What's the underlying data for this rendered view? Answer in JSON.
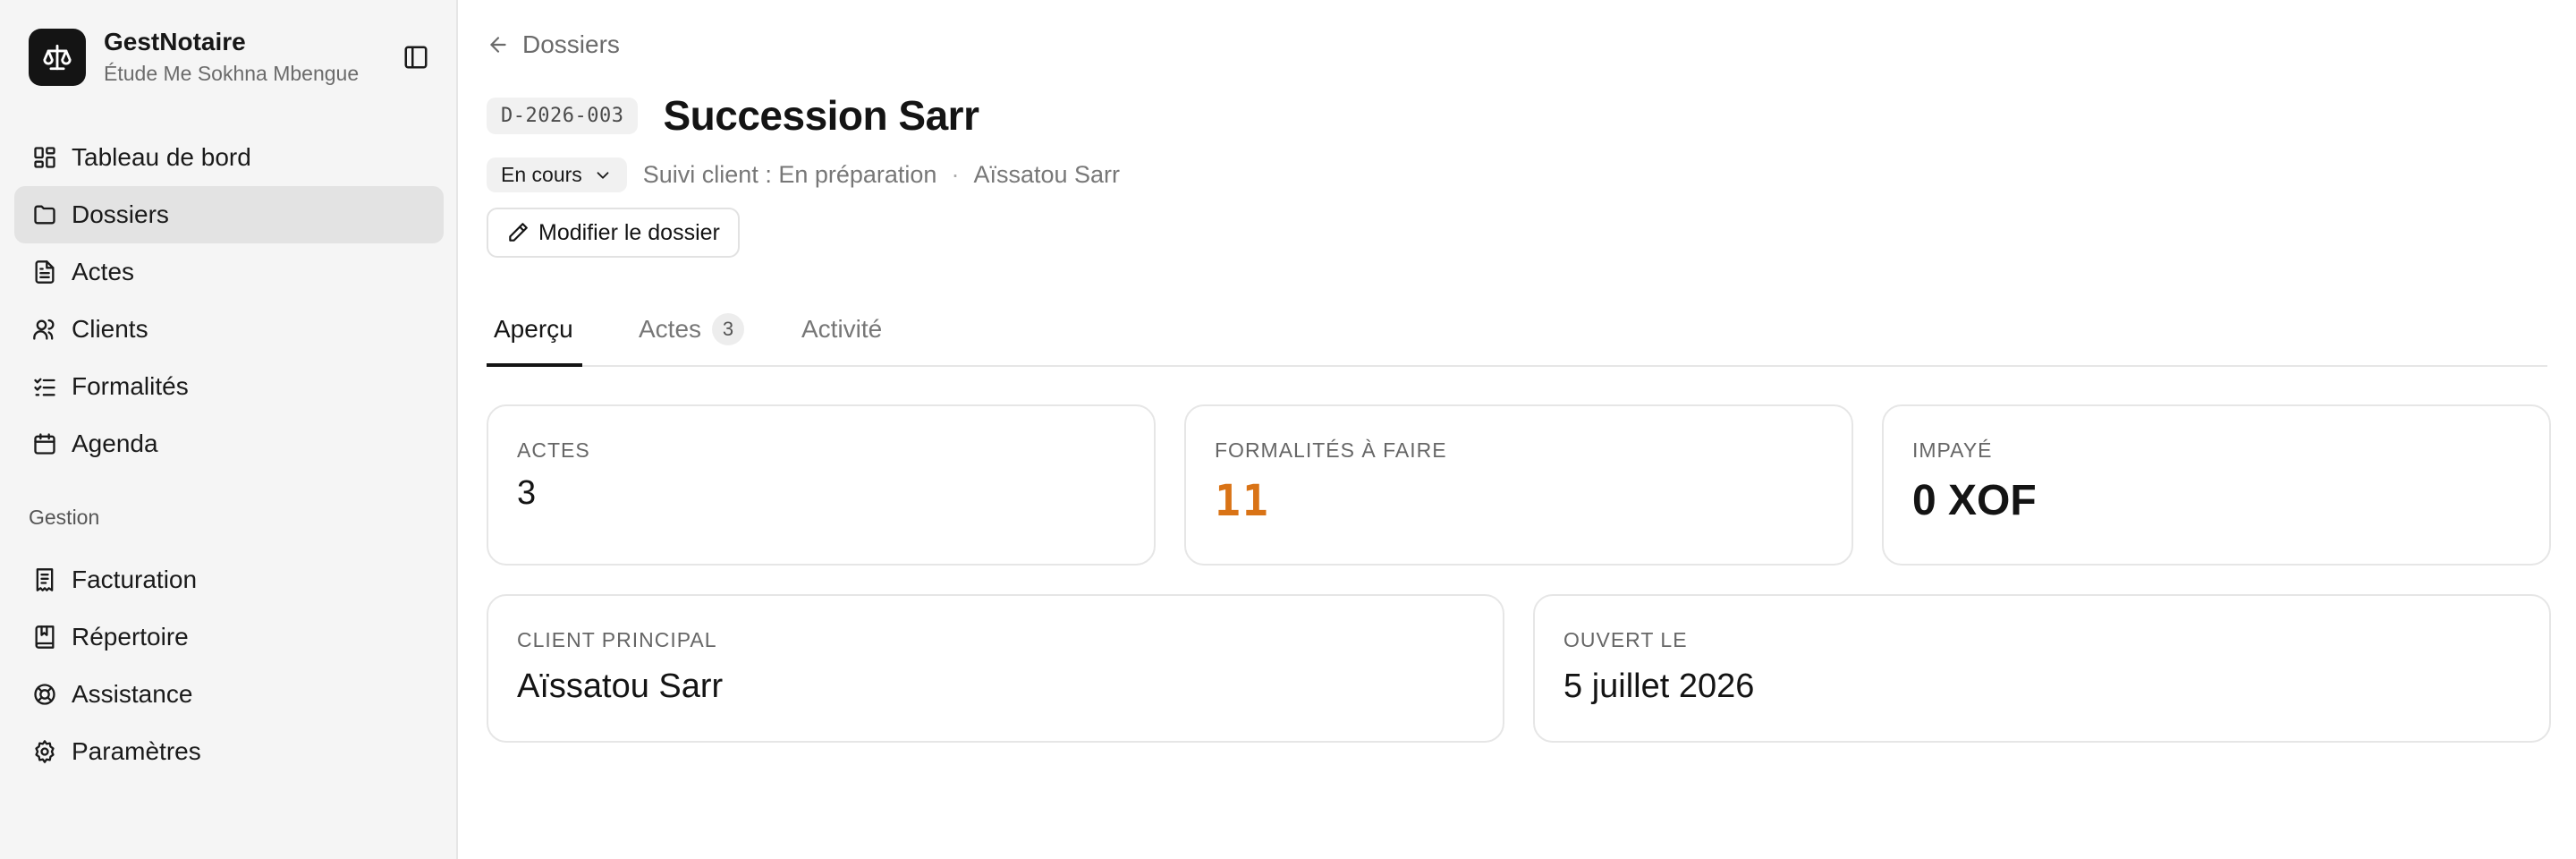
{
  "brand": {
    "name": "GestNotaire",
    "subtitle": "Étude Me Sokhna Mbengue"
  },
  "sidebar": {
    "items": [
      {
        "label": "Tableau de bord",
        "icon": "dashboard-icon"
      },
      {
        "label": "Dossiers",
        "icon": "folder-icon",
        "active": true
      },
      {
        "label": "Actes",
        "icon": "file-text-icon"
      },
      {
        "label": "Clients",
        "icon": "users-icon"
      },
      {
        "label": "Formalités",
        "icon": "list-checks-icon"
      },
      {
        "label": "Agenda",
        "icon": "calendar-icon"
      }
    ],
    "section_label": "Gestion",
    "section_items": [
      {
        "label": "Facturation",
        "icon": "receipt-icon"
      },
      {
        "label": "Répertoire",
        "icon": "book-icon"
      },
      {
        "label": "Assistance",
        "icon": "life-buoy-icon"
      },
      {
        "label": "Paramètres",
        "icon": "gear-icon"
      }
    ]
  },
  "breadcrumb": {
    "back_label": "Dossiers"
  },
  "dossier": {
    "reference": "D-2026-003",
    "title": "Succession Sarr",
    "status": "En cours",
    "client_follow": "Suivi client : En préparation",
    "separator": "·",
    "client_name": "Aïssatou Sarr",
    "edit_label": "Modifier le dossier"
  },
  "tabs": [
    {
      "label": "Aperçu",
      "active": true
    },
    {
      "label": "Actes",
      "count": "3"
    },
    {
      "label": "Activité"
    }
  ],
  "stats": {
    "actes": {
      "label": "ACTES",
      "value": "3"
    },
    "formalites": {
      "label": "FORMALITÉS À FAIRE",
      "value": "11"
    },
    "impaye": {
      "label": "IMPAYÉ",
      "value": "0 XOF"
    },
    "client": {
      "label": "CLIENT PRINCIPAL",
      "value": "Aïssatou Sarr"
    },
    "ouvert": {
      "label": "OUVERT LE",
      "value": "5 juillet 2026"
    }
  },
  "colors": {
    "accent_orange": "#d97316",
    "sidebar_bg": "#f5f5f5",
    "active_item_bg": "#e3e3e3"
  }
}
